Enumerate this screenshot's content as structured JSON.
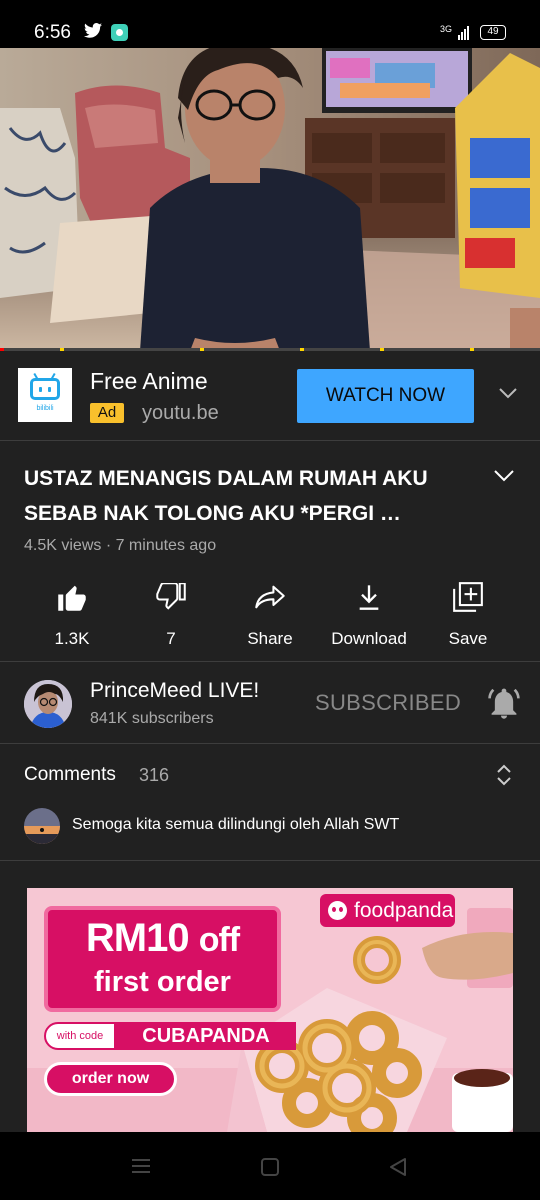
{
  "status_bar": {
    "time": "6:56",
    "network": "3G",
    "battery": "49"
  },
  "video": {
    "progress_fraction": 0.008
  },
  "ad": {
    "logo_text": "bilibili",
    "title": "Free Anime",
    "badge": "Ad",
    "url": "youtu.be",
    "cta": "WATCH NOW"
  },
  "video_info": {
    "title": "USTAZ MENANGIS DALAM RUMAH AKU SEBAB NAK TOLONG AKU *PERGI …",
    "meta": "4.5K views · 7 minutes ago"
  },
  "actions": [
    {
      "label": "1.3K",
      "icon": "thumbs-up-icon"
    },
    {
      "label": "7",
      "icon": "thumbs-down-icon"
    },
    {
      "label": "Share",
      "icon": "share-icon"
    },
    {
      "label": "Download",
      "icon": "download-icon"
    },
    {
      "label": "Save",
      "icon": "save-to-playlist-icon"
    }
  ],
  "channel": {
    "name": "PrinceMeed LIVE!",
    "subscribers": "841K subscribers",
    "subscribe_state": "SUBSCRIBED"
  },
  "comments": {
    "title": "Comments",
    "count": "316",
    "top_comment": "Semoga kita semua dilindungi oleh Allah SWT"
  },
  "banner": {
    "brand": "foodpanda",
    "headline_amount": "RM10",
    "headline_off": "off",
    "subline": "first order",
    "with_code": "with code",
    "code": "CUBAPANDA",
    "cta": "order now"
  },
  "colors": {
    "background": "#212121",
    "accent_blue": "#3ea6ff",
    "ad_badge": "#f9c02c",
    "foodpanda_pink": "#d70f64",
    "progress_red": "#ff0000"
  }
}
